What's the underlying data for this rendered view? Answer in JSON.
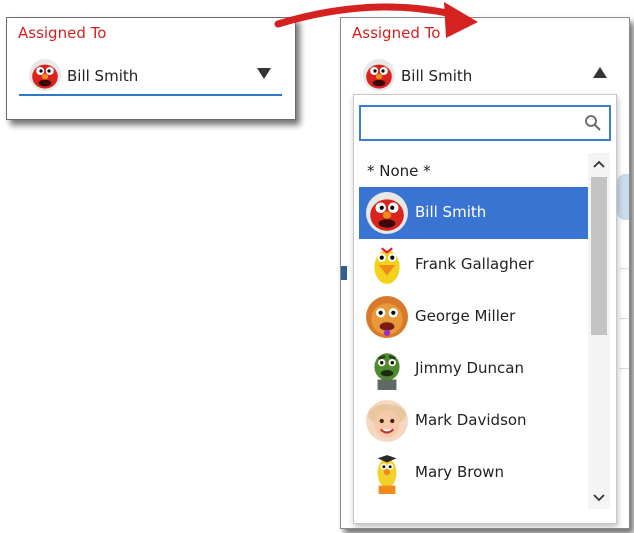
{
  "field": {
    "label": "Assigned To",
    "selected_user": "Bill Smith"
  },
  "search": {
    "value": "",
    "placeholder": ""
  },
  "dropdown": {
    "none_label": "* None *",
    "users": [
      {
        "name": "Bill Smith",
        "avatar": "red-monster-avatar",
        "selected": true
      },
      {
        "name": "Frank Gallagher",
        "avatar": "yellow-bird-avatar",
        "selected": false
      },
      {
        "name": "George Miller",
        "avatar": "orange-monster-avatar",
        "selected": false
      },
      {
        "name": "Jimmy Duncan",
        "avatar": "green-grouch-avatar",
        "selected": false
      },
      {
        "name": "Mark Davidson",
        "avatar": "child-face-avatar",
        "selected": false
      },
      {
        "name": "Mary Brown",
        "avatar": "yellow-puppet-avatar",
        "selected": false
      }
    ]
  },
  "colors": {
    "label": "#d61f1f",
    "focus_underline": "#2f77c8",
    "selection": "#3a74d2",
    "arrow": "#d62121"
  },
  "icons": {
    "collapsed_arrow": "triangle-down-icon",
    "expanded_arrow": "triangle-up-icon",
    "search": "search-icon",
    "scroll_up": "chevron-up-icon",
    "scroll_down": "chevron-down-icon",
    "transition": "curved-arrow-icon"
  }
}
